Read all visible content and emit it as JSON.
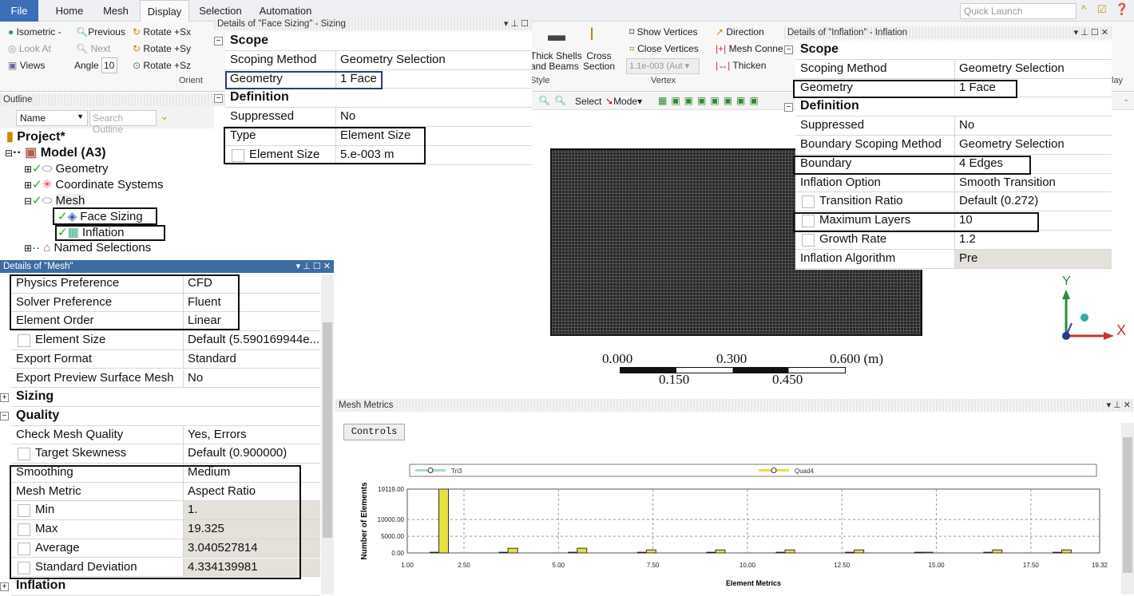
{
  "ribbon": {
    "tabs": [
      "File",
      "Home",
      "Mesh",
      "Display",
      "Selection",
      "Automation"
    ],
    "active_tab": "Display",
    "quick_launch_placeholder": "Quick Launch",
    "orient": {
      "isometric": "Isometric",
      "previous": "Previous",
      "rotate_sx": "Rotate +Sx",
      "look_at": "Look At",
      "next": "Next",
      "rotate_sy": "Rotate +Sy",
      "views": "Views",
      "angle_label": "Angle",
      "angle_value": "10",
      "rotate_sz": "Rotate +Sz",
      "group": "Orient"
    },
    "style": {
      "thick_shells": "Thick Shells",
      "and_beams": "and Beams",
      "cross": "Cross",
      "section": "Section",
      "group": "Style"
    },
    "vertex": {
      "show_vertices": "Show Vertices",
      "close_vertices": "Close Vertices",
      "size_value": "1.1e-003 (Aut",
      "group": "Vertex"
    },
    "edge": {
      "direction": "Direction",
      "mesh_connection": "Mesh Conne",
      "thicken": "Thicken"
    },
    "display_group": "lay",
    "toolbar": {
      "select": "Select",
      "mode": "Mode"
    }
  },
  "outline": {
    "title": "Outline",
    "name_filter": "Name",
    "search_placeholder": "Search Outline",
    "tree": {
      "project": "Project*",
      "model": "Model (A3)",
      "geometry": "Geometry",
      "coordinate_systems": "Coordinate Systems",
      "mesh": "Mesh",
      "face_sizing": "Face Sizing",
      "inflation": "Inflation",
      "named_selections": "Named Selections"
    }
  },
  "mesh_details": {
    "title": "Details of \"Mesh\"",
    "rows": [
      {
        "label": "Physics Preference",
        "value": "CFD"
      },
      {
        "label": "Solver Preference",
        "value": "Fluent"
      },
      {
        "label": "Element Order",
        "value": "Linear"
      },
      {
        "label": "Element Size",
        "value": "Default (5.590169944e...",
        "checkbox": true
      },
      {
        "label": "Export Format",
        "value": "Standard"
      },
      {
        "label": "Export Preview Surface Mesh",
        "value": "No"
      },
      {
        "label": "Sizing",
        "header": true,
        "expander": "+"
      },
      {
        "label": "Quality",
        "header": true,
        "expander": "-"
      },
      {
        "label": "Check Mesh Quality",
        "value": "Yes, Errors"
      },
      {
        "label": "Target Skewness",
        "value": "Default (0.900000)",
        "checkbox": true
      },
      {
        "label": "Smoothing",
        "value": "Medium"
      },
      {
        "label": "Mesh Metric",
        "value": "Aspect Ratio"
      },
      {
        "label": "Min",
        "value": "1.",
        "checkbox": true,
        "gray": true
      },
      {
        "label": "Max",
        "value": "19.325",
        "checkbox": true,
        "gray": true
      },
      {
        "label": "Average",
        "value": "3.040527814",
        "checkbox": true,
        "gray": true
      },
      {
        "label": "Standard Deviation",
        "value": "4.334139981",
        "checkbox": true,
        "gray": true
      },
      {
        "label": "Inflation",
        "header": true,
        "expander": "+"
      }
    ]
  },
  "face_sizing_details": {
    "title": "Details of \"Face Sizing\" - Sizing",
    "rows": [
      {
        "label": "Scope",
        "header": true,
        "expander": "-"
      },
      {
        "label": "Scoping Method",
        "value": "Geometry Selection"
      },
      {
        "label": "Geometry",
        "value": "1 Face"
      },
      {
        "label": "Definition",
        "header": true,
        "expander": "-"
      },
      {
        "label": "Suppressed",
        "value": "No"
      },
      {
        "label": "Type",
        "value": "Element Size"
      },
      {
        "label": "Element Size",
        "value": "5.e-003 m",
        "checkbox": true
      }
    ]
  },
  "inflation_details": {
    "title": "Details of \"Inflation\" - Inflation",
    "rows": [
      {
        "label": "Scope",
        "header": true,
        "expander": "-"
      },
      {
        "label": "Scoping Method",
        "value": "Geometry Selection"
      },
      {
        "label": "Geometry",
        "value": "1 Face"
      },
      {
        "label": "Definition",
        "header": true,
        "expander": "-"
      },
      {
        "label": "Suppressed",
        "value": "No"
      },
      {
        "label": "Boundary Scoping Method",
        "value": "Geometry Selection"
      },
      {
        "label": "Boundary",
        "value": "4 Edges"
      },
      {
        "label": "Inflation Option",
        "value": "Smooth Transition"
      },
      {
        "label": "Transition Ratio",
        "value": "Default (0.272)",
        "checkbox": true
      },
      {
        "label": "Maximum Layers",
        "value": "10",
        "checkbox": true
      },
      {
        "label": "Growth Rate",
        "value": "1.2",
        "checkbox": true
      },
      {
        "label": "Inflation Algorithm",
        "value": "Pre",
        "gray": true
      }
    ]
  },
  "viewport": {
    "scale_labels_top": [
      "0.000",
      "0.300",
      "0.600 (m)"
    ],
    "scale_labels_bottom": [
      "0.150",
      "0.450"
    ],
    "axis": {
      "x": "X",
      "y": "Y"
    }
  },
  "mesh_metrics": {
    "title": "Mesh Metrics",
    "controls_button": "Controls"
  },
  "chart_data": {
    "type": "bar",
    "xlabel": "Element Metrics",
    "ylabel": "Number of Elements",
    "xlim": [
      1.0,
      19.32
    ],
    "ylim": [
      0,
      19119
    ],
    "x_ticks": [
      "1.00",
      "2.50",
      "5.00",
      "7.50",
      "10.00",
      "12.50",
      "15.00",
      "17.50",
      "19.32"
    ],
    "y_ticks": [
      "0.00",
      "5000.00",
      "10000.00",
      "19119.00"
    ],
    "legend_position": "top",
    "grid": true,
    "bin_centers": [
      1.92,
      3.75,
      5.58,
      7.41,
      9.24,
      11.08,
      12.91,
      14.74,
      16.57,
      18.4
    ],
    "series": [
      {
        "name": "Tri3",
        "color": "#a8d8d8",
        "values": [
          200,
          200,
          200,
          200,
          200,
          200,
          200,
          200,
          200,
          200
        ]
      },
      {
        "name": "Quad4",
        "color": "#e8e040",
        "values": [
          19119,
          1400,
          1400,
          900,
          900,
          900,
          900,
          200,
          900,
          900
        ]
      }
    ]
  }
}
